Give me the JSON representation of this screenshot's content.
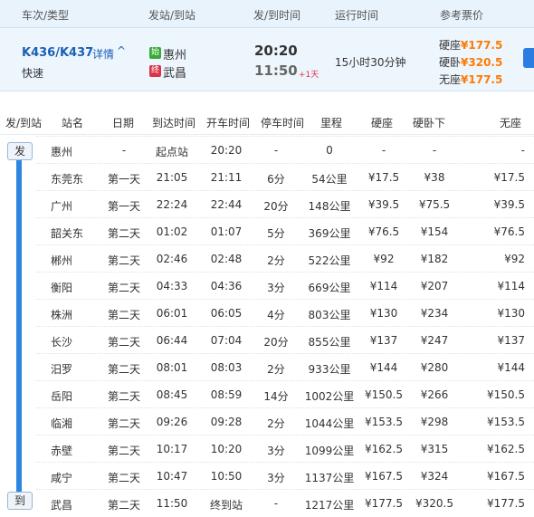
{
  "header": {
    "train_label": "车次/类型",
    "station_label": "发站/到站",
    "time_label": "发/到时间",
    "duration_label": "运行时间",
    "price_label": "参考票价"
  },
  "train": {
    "number": "K436/K437",
    "detail_link": "详情",
    "type": "快速",
    "from_badge": "始",
    "from_station": "惠州",
    "to_badge": "终",
    "to_station": "武昌",
    "depart_time": "20:20",
    "arrive_time": "11:50",
    "plus_day": "+1天",
    "duration": "15小时30分钟",
    "prices": [
      {
        "label": "硬座",
        "value": "¥177.5"
      },
      {
        "label": "硬卧",
        "value": "¥320.5"
      },
      {
        "label": "无座",
        "value": "¥177.5"
      }
    ],
    "badge_colors": {
      "from": "#3aa93a",
      "to": "#d9344a"
    }
  },
  "table": {
    "headers": {
      "mark": "发/到站",
      "name": "站名",
      "day": "日期",
      "arrive": "到达时间",
      "depart": "开车时间",
      "stop": "停车时间",
      "distance": "里程",
      "hard_seat": "硬座",
      "hard_sleeper": "硬卧下",
      "no_seat": "无座"
    },
    "start_mark": "发",
    "end_mark": "到",
    "rows": [
      {
        "name": "惠州",
        "day": "-",
        "arrive": "起点站",
        "depart": "20:20",
        "stop": "-",
        "distance": "0",
        "hs": "-",
        "hw": "-",
        "ws": "-"
      },
      {
        "name": "东莞东",
        "day": "第一天",
        "arrive": "21:05",
        "depart": "21:11",
        "stop": "6分",
        "distance": "54公里",
        "hs": "¥17.5",
        "hw": "¥38",
        "ws": "¥17.5"
      },
      {
        "name": "广州",
        "day": "第一天",
        "arrive": "22:24",
        "depart": "22:44",
        "stop": "20分",
        "distance": "148公里",
        "hs": "¥39.5",
        "hw": "¥75.5",
        "ws": "¥39.5"
      },
      {
        "name": "韶关东",
        "day": "第二天",
        "arrive": "01:02",
        "depart": "01:07",
        "stop": "5分",
        "distance": "369公里",
        "hs": "¥76.5",
        "hw": "¥154",
        "ws": "¥76.5"
      },
      {
        "name": "郴州",
        "day": "第二天",
        "arrive": "02:46",
        "depart": "02:48",
        "stop": "2分",
        "distance": "522公里",
        "hs": "¥92",
        "hw": "¥182",
        "ws": "¥92"
      },
      {
        "name": "衡阳",
        "day": "第二天",
        "arrive": "04:33",
        "depart": "04:36",
        "stop": "3分",
        "distance": "669公里",
        "hs": "¥114",
        "hw": "¥207",
        "ws": "¥114"
      },
      {
        "name": "株洲",
        "day": "第二天",
        "arrive": "06:01",
        "depart": "06:05",
        "stop": "4分",
        "distance": "803公里",
        "hs": "¥130",
        "hw": "¥234",
        "ws": "¥130"
      },
      {
        "name": "长沙",
        "day": "第二天",
        "arrive": "06:44",
        "depart": "07:04",
        "stop": "20分",
        "distance": "855公里",
        "hs": "¥137",
        "hw": "¥247",
        "ws": "¥137"
      },
      {
        "name": "汨罗",
        "day": "第二天",
        "arrive": "08:01",
        "depart": "08:03",
        "stop": "2分",
        "distance": "933公里",
        "hs": "¥144",
        "hw": "¥280",
        "ws": "¥144"
      },
      {
        "name": "岳阳",
        "day": "第二天",
        "arrive": "08:45",
        "depart": "08:59",
        "stop": "14分",
        "distance": "1002公里",
        "hs": "¥150.5",
        "hw": "¥266",
        "ws": "¥150.5"
      },
      {
        "name": "临湘",
        "day": "第二天",
        "arrive": "09:26",
        "depart": "09:28",
        "stop": "2分",
        "distance": "1044公里",
        "hs": "¥153.5",
        "hw": "¥298",
        "ws": "¥153.5"
      },
      {
        "name": "赤壁",
        "day": "第二天",
        "arrive": "10:17",
        "depart": "10:20",
        "stop": "3分",
        "distance": "1099公里",
        "hs": "¥162.5",
        "hw": "¥315",
        "ws": "¥162.5"
      },
      {
        "name": "咸宁",
        "day": "第二天",
        "arrive": "10:47",
        "depart": "10:50",
        "stop": "3分",
        "distance": "1137公里",
        "hs": "¥167.5",
        "hw": "¥324",
        "ws": "¥167.5"
      },
      {
        "name": "武昌",
        "day": "第二天",
        "arrive": "11:50",
        "depart": "终到站",
        "stop": "-",
        "distance": "1217公里",
        "hs": "¥177.5",
        "hw": "¥320.5",
        "ws": "¥177.5"
      }
    ]
  },
  "colors": {
    "accent": "#1a5fb4",
    "price": "#ff7a00",
    "route_line": "#2f86e0"
  }
}
